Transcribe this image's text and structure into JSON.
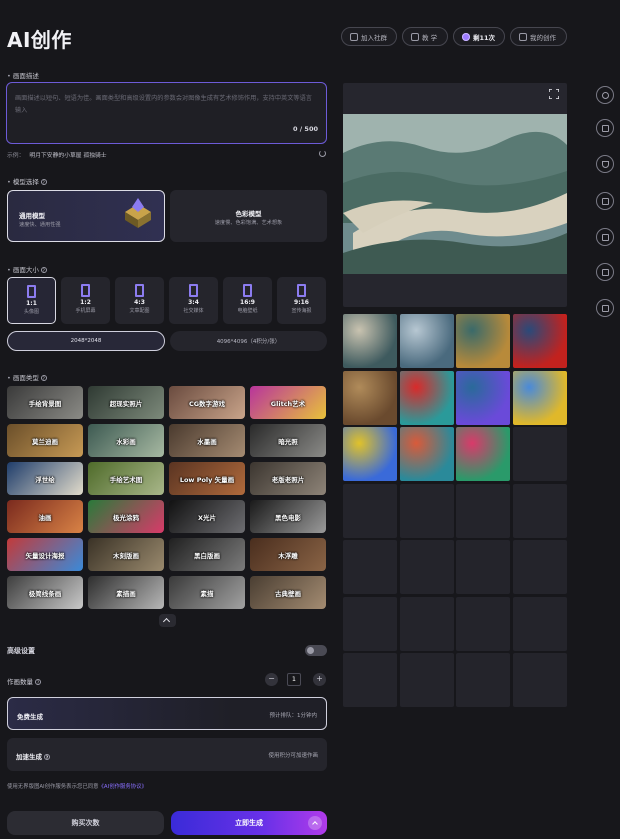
{
  "header": {
    "title": "AI创作",
    "pills": [
      {
        "label": "加入社群"
      },
      {
        "label": "教 学"
      },
      {
        "label": "剩11次"
      },
      {
        "label": "我的创作"
      }
    ]
  },
  "prompt": {
    "section_label": "画面描述",
    "placeholder": "画面描述以短句、短语为佳。画面类型和高级设置内的参数会对图像生成有艺术修饰作用，支持中英文等语言输入",
    "counter": "0 / 500",
    "hint_label": "示例：",
    "hint_example": "明月下安静的小草屋 孤独骑士"
  },
  "model": {
    "section_label": "模型选择",
    "options": [
      {
        "title": "通用模型",
        "desc": "速度快、通用性强"
      },
      {
        "title": "色彩模型",
        "desc": "速度慢、色彩饱满、艺术想象"
      }
    ]
  },
  "size": {
    "section_label": "画面大小",
    "ratios": [
      {
        "ratio": "1:1",
        "label": "头像图"
      },
      {
        "ratio": "1:2",
        "label": "手机屏幕"
      },
      {
        "ratio": "4:3",
        "label": "文章配图"
      },
      {
        "ratio": "3:4",
        "label": "社交媒体"
      },
      {
        "ratio": "16:9",
        "label": "电脑壁纸"
      },
      {
        "ratio": "9:16",
        "label": "宣传海报"
      }
    ],
    "resolutions": [
      {
        "label": "2048*2048"
      },
      {
        "label": "4096*4096（4积分/张）"
      }
    ]
  },
  "style": {
    "section_label": "画面类型",
    "types": [
      {
        "label": "手绘背景图",
        "colors": [
          "#3a3a3a",
          "#8b8b86"
        ]
      },
      {
        "label": "超现实照片",
        "colors": [
          "#2f3a33",
          "#7d8a7b"
        ]
      },
      {
        "label": "CG数字游戏",
        "colors": [
          "#6a4b3f",
          "#c9a48a"
        ]
      },
      {
        "label": "Glitch艺术",
        "colors": [
          "#b8349c",
          "#e8c23a"
        ]
      },
      {
        "label": "莫兰迪画",
        "colors": [
          "#6b4f2a",
          "#c79a55"
        ]
      },
      {
        "label": "水彩画",
        "colors": [
          "#3d5a52",
          "#a7b9a2"
        ]
      },
      {
        "label": "水墨画",
        "colors": [
          "#4a3a2e",
          "#a58b72"
        ]
      },
      {
        "label": "暗光照",
        "colors": [
          "#2a2a2a",
          "#8b8b88"
        ]
      },
      {
        "label": "浮世绘",
        "colors": [
          "#1f3d6b",
          "#e2dccb"
        ]
      },
      {
        "label": "手绘艺术图",
        "colors": [
          "#4f6b2a",
          "#a9b78a"
        ]
      },
      {
        "label": "Low Poly 矢量画",
        "colors": [
          "#5a3422",
          "#b06a3c"
        ]
      },
      {
        "label": "老版老照片",
        "colors": [
          "#3c3630",
          "#8e8478"
        ]
      },
      {
        "label": "油画",
        "colors": [
          "#7a2a1e",
          "#d98346"
        ]
      },
      {
        "label": "极光涂鸦",
        "colors": [
          "#2a7a3a",
          "#d93a6a"
        ]
      },
      {
        "label": "X光片",
        "colors": [
          "#111111",
          "#6e6e72"
        ]
      },
      {
        "label": "黑色电影",
        "colors": [
          "#1a1a1a",
          "#9a9a9a"
        ]
      },
      {
        "label": "矢量设计海报",
        "colors": [
          "#c23a3a",
          "#3a8ad9"
        ]
      },
      {
        "label": "木刻版画",
        "colors": [
          "#3a3226",
          "#9a8a6e"
        ]
      },
      {
        "label": "黑白版画",
        "colors": [
          "#202020",
          "#7c7c7c"
        ]
      },
      {
        "label": "木浮雕",
        "colors": [
          "#4a2e1e",
          "#8a6446"
        ]
      },
      {
        "label": "极简线条画",
        "colors": [
          "#3e3e3e",
          "#c9c9c9"
        ]
      },
      {
        "label": "素描画",
        "colors": [
          "#2e2e2e",
          "#b7b7b7"
        ]
      },
      {
        "label": "素描",
        "colors": [
          "#3a3a3a",
          "#a2a2a2"
        ]
      },
      {
        "label": "古典壁画",
        "colors": [
          "#4a3e32",
          "#a48c72"
        ]
      }
    ]
  },
  "advanced": {
    "label": "高级设置",
    "count_label": "作画数量",
    "count_value": "1",
    "minus": "−",
    "plus": "+"
  },
  "generate": {
    "free_title": "免费生成",
    "free_right": "预计排队：1分钟内",
    "fast_title": "加速生成",
    "fast_right": "使用积分可加速作画",
    "agreement_text": "使用无界版图AI创作服务表示您已同意",
    "agreement_link": "《AI创作服务协议》",
    "buy_label": "购买次数",
    "go_label": "立即生成"
  },
  "gallery": {
    "thumbs": [
      {
        "name": "mountain-river",
        "colors": [
          "#3e5a5e",
          "#c9c3b0"
        ]
      },
      {
        "name": "misty-mountains",
        "colors": [
          "#4a6a7e",
          "#b7c7d2"
        ]
      },
      {
        "name": "golden-mountains",
        "colors": [
          "#b88a3a",
          "#3a6a6a"
        ]
      },
      {
        "name": "red-flowers",
        "colors": [
          "#c2221e",
          "#2a4a7a"
        ]
      },
      {
        "name": "canyon",
        "colors": [
          "#6a4a2e",
          "#b08b5a"
        ]
      },
      {
        "name": "coca-cola-portrait",
        "colors": [
          "#2a9a9a",
          "#d92a2a"
        ]
      },
      {
        "name": "purple-flowers",
        "colors": [
          "#6a4ad9",
          "#2a6a9a"
        ]
      },
      {
        "name": "sunflower-field",
        "colors": [
          "#e0b82a",
          "#4a8ad9"
        ]
      },
      {
        "name": "sunflowers-blue",
        "colors": [
          "#3a6ad9",
          "#e0c22a"
        ]
      },
      {
        "name": "food-bowls",
        "colors": [
          "#2a8a9a",
          "#d95a3a"
        ]
      },
      {
        "name": "flower-pattern",
        "colors": [
          "#2a9a6a",
          "#d93a6a"
        ]
      }
    ],
    "empty_count": 17
  },
  "rail": {
    "icons": [
      "history-icon",
      "document-icon",
      "trophy-icon",
      "share-icon",
      "edit-icon",
      "file-icon",
      "trash-icon"
    ]
  },
  "colors": {
    "accent": "#6a31e8",
    "background": "#17171b",
    "card": "#25252c"
  }
}
